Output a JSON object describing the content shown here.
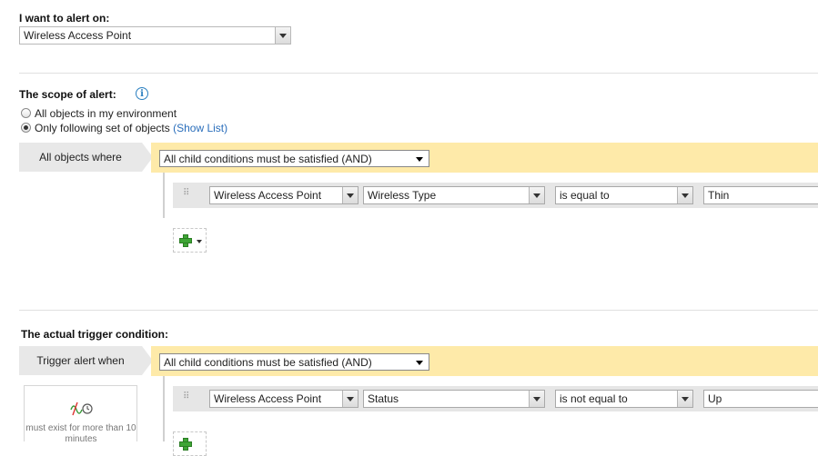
{
  "alert_on": {
    "heading": "I want to alert on:",
    "selected": "Wireless Access Point"
  },
  "scope": {
    "heading": "The scope of alert:",
    "info_icon": "info-icon",
    "options": [
      {
        "label": "All objects in my environment",
        "selected": false
      },
      {
        "label": "Only following set of objects",
        "selected": true
      }
    ],
    "show_list_link": "(Show List)",
    "where_label": "All objects where",
    "logic_select": "All child conditions must be satisfied (AND)",
    "condition": {
      "object": "Wireless Access Point",
      "property": "Wireless Type",
      "operator": "is equal to",
      "value": "Thin"
    }
  },
  "trigger": {
    "heading": "The actual trigger condition:",
    "when_label": "Trigger alert when",
    "logic_select": "All child conditions must be satisfied (AND)",
    "condition": {
      "object": "Wireless Access Point",
      "property": "Status",
      "operator": "is not equal to",
      "value": "Up"
    },
    "time_card_text": "must exist for more than 10 minutes",
    "time_card_icon": "signal-clock-icon"
  },
  "colors": {
    "yellow_bar": "#feeaa9",
    "grey_label": "#e8e8e8",
    "link": "#2a6ebb",
    "add_green": "#3ea535"
  }
}
